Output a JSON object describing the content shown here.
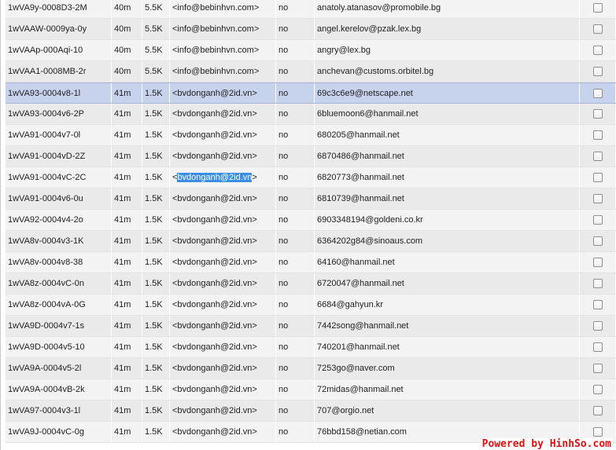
{
  "queue": {
    "rows": [
      {
        "id": "1wVA9y-0008D3-2M",
        "age": "40m",
        "size": "5.5K",
        "from": "<info@bebinhvn.com>",
        "frozen": "no",
        "recipient": "anatoly.atanasov@promobile.bg"
      },
      {
        "id": "1wVAAW-0009ya-0y",
        "age": "40m",
        "size": "5.5K",
        "from": "<info@bebinhvn.com>",
        "frozen": "no",
        "recipient": "angel.kerelov@pzak.lex.bg"
      },
      {
        "id": "1wVAAp-000Aqi-10",
        "age": "40m",
        "size": "5.5K",
        "from": "<info@bebinhvn.com>",
        "frozen": "no",
        "recipient": "angry@lex.bg"
      },
      {
        "id": "1wVAA1-0008MB-2r",
        "age": "40m",
        "size": "5.5K",
        "from": "<info@bebinhvn.com>",
        "frozen": "no",
        "recipient": "anchevan@customs.orbitel.bg"
      },
      {
        "id": "1wVA93-0004v8-1l",
        "age": "41m",
        "size": "1.5K",
        "from": "<bvdonganh@2id.vn>",
        "frozen": "no",
        "recipient": "69c3c6e9@netscape.net"
      },
      {
        "id": "1wVA93-0004v6-2P",
        "age": "41m",
        "size": "1.5K",
        "from": "<bvdonganh@2id.vn>",
        "frozen": "no",
        "recipient": "6bluemoon6@hanmail.net"
      },
      {
        "id": "1wVA91-0004v7-0l",
        "age": "41m",
        "size": "1.5K",
        "from": "<bvdonganh@2id.vn>",
        "frozen": "no",
        "recipient": "680205@hanmail.net"
      },
      {
        "id": "1wVA91-0004vD-2Z",
        "age": "41m",
        "size": "1.5K",
        "from": "<bvdonganh@2id.vn>",
        "frozen": "no",
        "recipient": "6870486@hanmail.net"
      },
      {
        "id": "1wVA91-0004vC-2C",
        "age": "41m",
        "size": "1.5K",
        "from": "<bvdonganh@2id.vn>",
        "frozen": "no",
        "recipient": "6820773@hanmail.net"
      },
      {
        "id": "1wVA91-0004v6-0u",
        "age": "41m",
        "size": "1.5K",
        "from": "<bvdonganh@2id.vn>",
        "frozen": "no",
        "recipient": "6810739@hanmail.net"
      },
      {
        "id": "1wVA92-0004v4-2o",
        "age": "41m",
        "size": "1.5K",
        "from": "<bvdonganh@2id.vn>",
        "frozen": "no",
        "recipient": "6903348194@goldeni.co.kr"
      },
      {
        "id": "1wVA8v-0004v3-1K",
        "age": "41m",
        "size": "1.5K",
        "from": "<bvdonganh@2id.vn>",
        "frozen": "no",
        "recipient": "6364202g84@sinoaus.com"
      },
      {
        "id": "1wVA8v-0004v8-38",
        "age": "41m",
        "size": "1.5K",
        "from": "<bvdonganh@2id.vn>",
        "frozen": "no",
        "recipient": "64160@hanmail.net"
      },
      {
        "id": "1wVA8z-0004vC-0n",
        "age": "41m",
        "size": "1.5K",
        "from": "<bvdonganh@2id.vn>",
        "frozen": "no",
        "recipient": "6720047@hanmail.net"
      },
      {
        "id": "1wVA8z-0004vA-0G",
        "age": "41m",
        "size": "1.5K",
        "from": "<bvdonganh@2id.vn>",
        "frozen": "no",
        "recipient": "6684@gahyun.kr"
      },
      {
        "id": "1wVA9D-0004v7-1s",
        "age": "41m",
        "size": "1.5K",
        "from": "<bvdonganh@2id.vn>",
        "frozen": "no",
        "recipient": "7442song@hanmail.net"
      },
      {
        "id": "1wVA9D-0004v5-10",
        "age": "41m",
        "size": "1.5K",
        "from": "<bvdonganh@2id.vn>",
        "frozen": "no",
        "recipient": "740201@hanmail.net"
      },
      {
        "id": "1wVA9A-0004v5-2l",
        "age": "41m",
        "size": "1.5K",
        "from": "<bvdonganh@2id.vn>",
        "frozen": "no",
        "recipient": "7253go@naver.com"
      },
      {
        "id": "1wVA9A-0004vB-2k",
        "age": "41m",
        "size": "1.5K",
        "from": "<bvdonganh@2id.vn>",
        "frozen": "no",
        "recipient": "72midas@hanmail.net"
      },
      {
        "id": "1wVA97-0004v3-1l",
        "age": "41m",
        "size": "1.5K",
        "from": "<bvdonganh@2id.vn>",
        "frozen": "no",
        "recipient": "707@orgio.net"
      },
      {
        "id": "1wVA9J-0004vC-0g",
        "age": "41m",
        "size": "1.5K",
        "from": "<bvdonganh@2id.vn>",
        "frozen": "no",
        "recipient": "76bbd158@netian.com"
      }
    ],
    "selected_row_index": 4,
    "text_selection": {
      "row_index": 8,
      "before": "<",
      "selected": "bvdonganh@2id.vn",
      "after": ">"
    },
    "colors": {
      "row": "#f3f3f3",
      "row_alt": "#eaeaea",
      "row_selected": "#c7d2ec",
      "text_highlight": "#3a8ee6"
    }
  },
  "watermark": {
    "text": "Powered by HinhSo.com",
    "color": "#e01010"
  }
}
